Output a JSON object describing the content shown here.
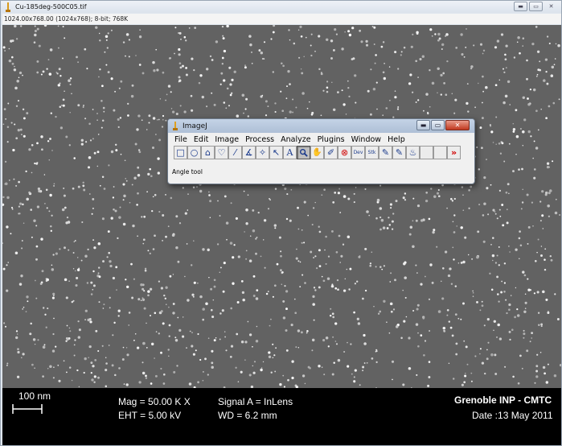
{
  "image_window": {
    "title": "Cu-185deg-500C05.tif",
    "info": "1024.00x768.00  (1024x768); 8-bit; 768K",
    "controls": [
      "minimize",
      "maximize",
      "close"
    ]
  },
  "sem_databar": {
    "scale_label": "100 nm",
    "mag": "Mag =  50.00 K X",
    "eht": "EHT =  5.00 kV",
    "signal": "Signal A = InLens",
    "wd": "WD =  6.2 mm",
    "institution": "Grenoble INP - CMTC",
    "date": "Date :13 May 2011"
  },
  "imagej": {
    "title": "ImageJ",
    "menus": [
      "File",
      "Edit",
      "Image",
      "Process",
      "Analyze",
      "Plugins",
      "Window",
      "Help"
    ],
    "tools": [
      {
        "name": "rectangle-tool",
        "glyph": "□"
      },
      {
        "name": "oval-tool",
        "glyph": "○"
      },
      {
        "name": "polygon-tool",
        "glyph": "⌂"
      },
      {
        "name": "freehand-tool",
        "glyph": "♡"
      },
      {
        "name": "line-tool",
        "glyph": "⁄"
      },
      {
        "name": "angle-tool",
        "glyph": "∡"
      },
      {
        "name": "point-tool",
        "glyph": "✧"
      },
      {
        "name": "wand-tool",
        "glyph": "↖"
      },
      {
        "name": "text-tool",
        "glyph": "A"
      },
      {
        "name": "magnifier-tool",
        "glyph": "🔍"
      },
      {
        "name": "hand-tool",
        "glyph": "✋"
      },
      {
        "name": "dropper-tool",
        "glyph": "✐"
      },
      {
        "name": "stop-tool",
        "glyph": "⊗"
      },
      {
        "name": "dev-tool",
        "glyph": "Dev"
      },
      {
        "name": "stk-tool",
        "glyph": "Stk"
      },
      {
        "name": "pencil-tool",
        "glyph": "✎"
      },
      {
        "name": "brush-tool",
        "glyph": "✎"
      },
      {
        "name": "flood-fill-tool",
        "glyph": "♨"
      },
      {
        "name": "empty-slot-1",
        "glyph": ""
      },
      {
        "name": "empty-slot-2",
        "glyph": ""
      },
      {
        "name": "more-tools",
        "glyph": "»"
      }
    ],
    "selected_tool": "magnifier-tool",
    "status": "Angle tool"
  },
  "colors": {
    "sem_background": "#626262",
    "databar": "#000000",
    "ij_close": "#c0391f",
    "ij_icon_blue": "#1a3a8c",
    "more_tools_red": "#d00000"
  }
}
